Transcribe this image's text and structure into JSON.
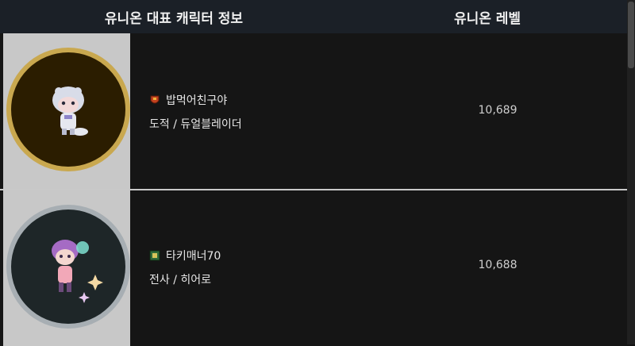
{
  "header": {
    "col_character": "유니온 대표 캐릭터 정보",
    "col_level": "유니온 레벨"
  },
  "rows": [
    {
      "name": "밥먹어친구야",
      "job": "도적 / 듀얼블레이더",
      "level": "10,689",
      "guild_icon": "guild-emblem-red"
    },
    {
      "name": "타키매너70",
      "job": "전사 / 히어로",
      "level": "10,688",
      "guild_icon": "guild-emblem-green"
    }
  ]
}
